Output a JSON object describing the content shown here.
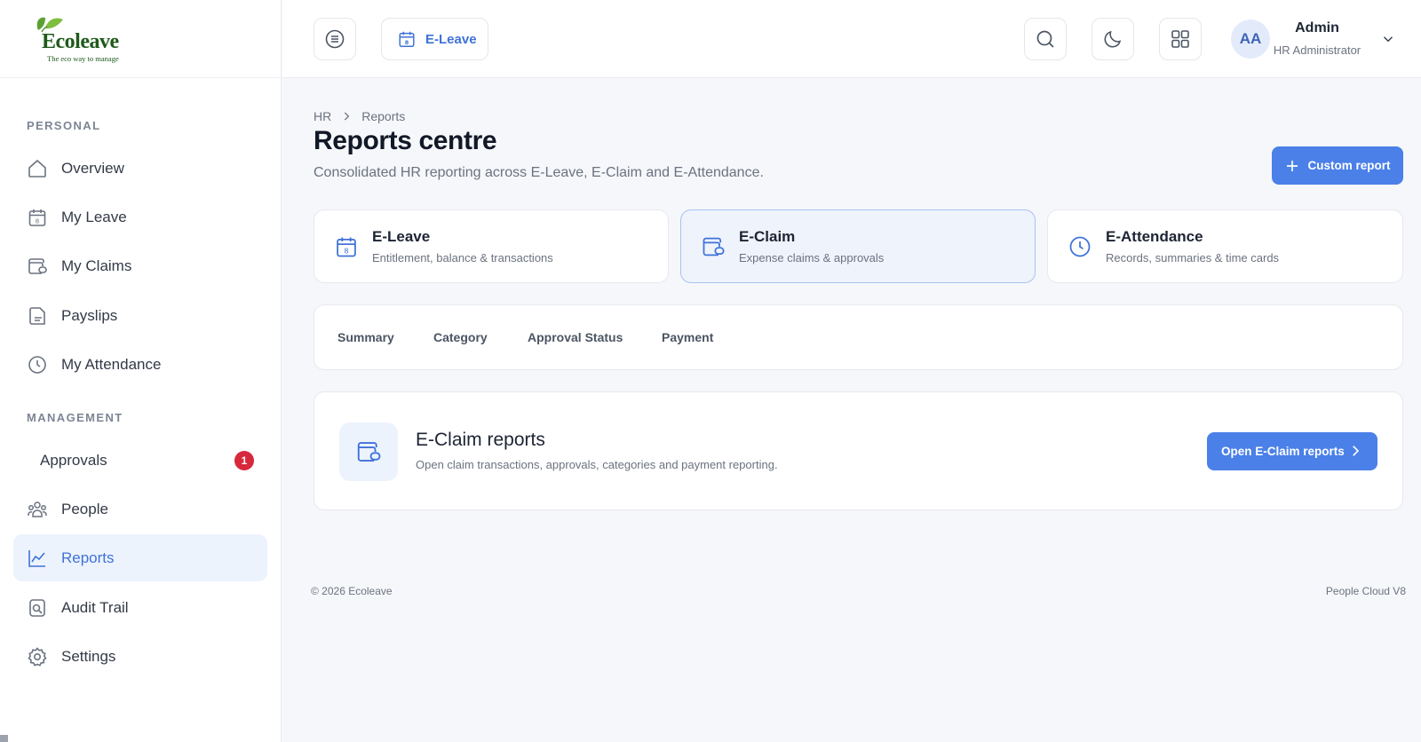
{
  "brand": {
    "name": "Ecoleave",
    "tagline": "The eco way to manage",
    "accent": "#4a80e8",
    "leaf": "#4d9a2a"
  },
  "sidebar": {
    "personal_label": "PERSONAL",
    "management_label": "MANAGEMENT",
    "personal_items": [
      {
        "label": "Overview",
        "icon": "home-icon"
      },
      {
        "label": "My Leave",
        "icon": "calendar-icon"
      },
      {
        "label": "My Claims",
        "icon": "wallet-icon"
      },
      {
        "label": "Payslips",
        "icon": "document-icon"
      },
      {
        "label": "My Attendance",
        "icon": "clock-icon"
      }
    ],
    "management_items": [
      {
        "label": "Approvals",
        "badge": "1"
      },
      {
        "label": "People",
        "icon": "people-icon"
      },
      {
        "label": "Reports",
        "icon": "chart-icon",
        "active": true
      },
      {
        "label": "Audit Trail",
        "icon": "audit-icon"
      },
      {
        "label": "Settings",
        "icon": "gear-icon"
      }
    ]
  },
  "topbar": {
    "module_label": "E-Leave",
    "calendar_day": "8",
    "user": {
      "initials": "AA",
      "name": "Admin",
      "role": "HR Administrator"
    }
  },
  "page": {
    "breadcrumb": [
      "HR",
      "Reports"
    ],
    "title": "Reports centre",
    "subtitle": "Consolidated HR reporting across E-Leave, E-Claim and E-Attendance.",
    "custom_report_label": "Custom report"
  },
  "modules": [
    {
      "title": "E-Leave",
      "desc": "Entitlement, balance & transactions"
    },
    {
      "title": "E-Claim",
      "desc": "Expense claims & approvals",
      "active": true
    },
    {
      "title": "E-Attendance",
      "desc": "Records, summaries & time cards"
    }
  ],
  "tabs": [
    "Summary",
    "Category",
    "Approval Status",
    "Payment"
  ],
  "report_card": {
    "title": "E-Claim reports",
    "desc": "Open claim transactions, approvals, categories and payment reporting.",
    "button_label": "Open E-Claim reports"
  },
  "footer": {
    "copyright": "© 2026 Ecoleave",
    "version": "People Cloud V8"
  }
}
